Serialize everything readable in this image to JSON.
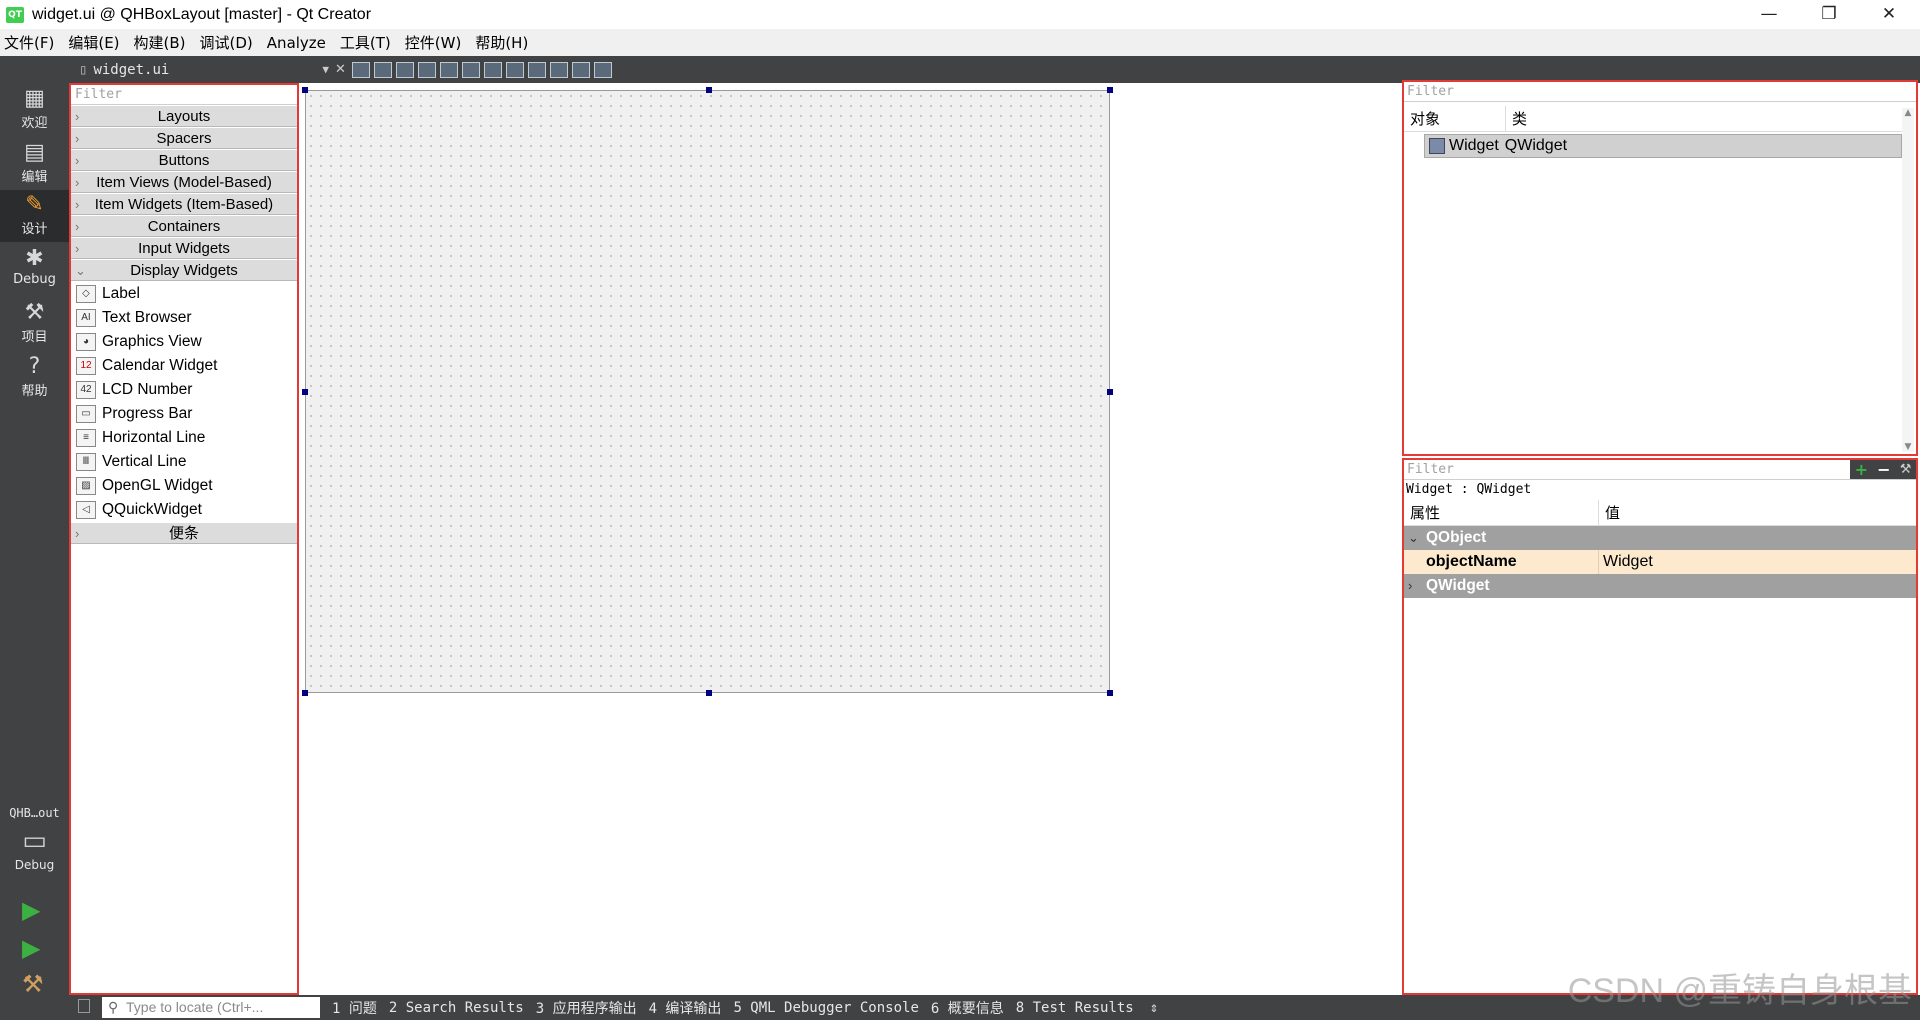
{
  "window": {
    "app_icon": "QT",
    "title": "widget.ui @ QHBoxLayout [master] - Qt Creator",
    "minimize": "—",
    "restore": "❐",
    "close": "✕"
  },
  "menu": [
    "文件(F)",
    "编辑(E)",
    "构建(B)",
    "调试(D)",
    "Analyze",
    "工具(T)",
    "控件(W)",
    "帮助(H)"
  ],
  "modes": [
    {
      "label": "欢迎",
      "icon": "grid-icon"
    },
    {
      "label": "编辑",
      "icon": "edit-doc-icon"
    },
    {
      "label": "设计",
      "icon": "pencil-icon"
    },
    {
      "label": "Debug",
      "icon": "bug-icon"
    },
    {
      "label": "项目",
      "icon": "wrench-icon"
    },
    {
      "label": "帮助",
      "icon": "help-icon"
    }
  ],
  "kit": {
    "project": "QHB…out",
    "config": "Debug"
  },
  "editor_toolbar": {
    "file": "widget.ui"
  },
  "widget_box": {
    "filter_placeholder": "Filter",
    "categories": [
      "Layouts",
      "Spacers",
      "Buttons",
      "Item Views (Model-Based)",
      "Item Widgets (Item-Based)",
      "Containers",
      "Input Widgets",
      "Display Widgets"
    ],
    "display_items": [
      "Label",
      "Text Browser",
      "Graphics View",
      "Calendar Widget",
      "LCD Number",
      "Progress Bar",
      "Horizontal Line",
      "Vertical Line",
      "OpenGL Widget",
      "QQuickWidget"
    ],
    "last_category": "便条"
  },
  "object_inspector": {
    "filter_placeholder": "Filter",
    "col_object": "对象",
    "col_class": "类",
    "row_object": "Widget",
    "row_class": "QWidget"
  },
  "property_editor": {
    "filter_placeholder": "Filter",
    "context": "Widget : QWidget",
    "col_property": "属性",
    "col_value": "值",
    "section1": "QObject",
    "prop_name": "objectName",
    "prop_value": "Widget",
    "section2": "QWidget"
  },
  "statusbar": {
    "locate_placeholder": "Type to locate (Ctrl+...",
    "panes": [
      "1 问题",
      "2 Search Results",
      "3 应用程序输出",
      "4 编译输出",
      "5 QML Debugger Console",
      "6 概要信息",
      "8 Test Results"
    ]
  },
  "watermark": "CSDN @重铸自身根基"
}
